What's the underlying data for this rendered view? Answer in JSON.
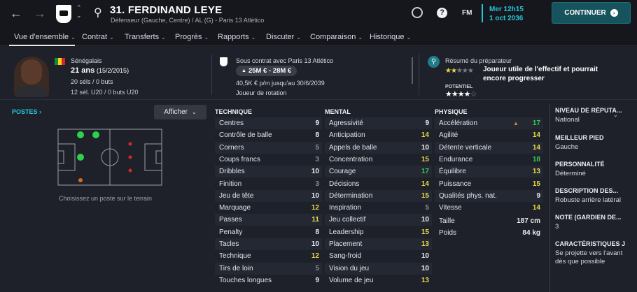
{
  "header": {
    "player_title": "31. FERDINAND LEYE",
    "subtitle": "Défenseur (Gauche, Centre) / AL (G) - Paris 13 Atlético",
    "date_line1": "Mer 12h15",
    "date_line2": "1 oct 2036",
    "fm_label": "FM",
    "continue_label": "CONTINUER"
  },
  "tabs": [
    {
      "label": "Vue d'ensemble"
    },
    {
      "label": "Contrat"
    },
    {
      "label": "Transferts"
    },
    {
      "label": "Progrès"
    },
    {
      "label": "Rapports"
    },
    {
      "label": "Discuter"
    },
    {
      "label": "Comparaison"
    },
    {
      "label": "Historique"
    }
  ],
  "bio": {
    "nationality": "Sénégalais",
    "age": "21 ans",
    "birth": "(15/2/2015)",
    "caps": "20 séls / 0 buts",
    "u20": "12 sél. U20 / 0 buts U20"
  },
  "contract": {
    "line1": "Sous contrat avec Paris 13 Atlético",
    "value": "25M € - 28M €",
    "wage": "40,5K € p/m jusqu'au 30/6/2039",
    "role": "Joueur de rotation"
  },
  "coach": {
    "title": "Résumé du préparateur",
    "summary": "Joueur utile de l'effectif et pourrait encore progresser",
    "potential_label": "POTENTIEL",
    "ability_stars": 2.5,
    "potential_stars": 4.5
  },
  "positions": {
    "label": "POSTES",
    "button": "Afficher",
    "hint": "Choisissez un poste sur le terrain"
  },
  "technique": {
    "title": "TECHNIQUE",
    "rows": [
      {
        "name": "Centres",
        "value": "9"
      },
      {
        "name": "Contrôle de balle",
        "value": "8"
      },
      {
        "name": "Corners",
        "value": "5"
      },
      {
        "name": "Coups francs",
        "value": "3"
      },
      {
        "name": "Dribbles",
        "value": "10"
      },
      {
        "name": "Finition",
        "value": "3"
      },
      {
        "name": "Jeu de tête",
        "value": "10"
      },
      {
        "name": "Marquage",
        "value": "12"
      },
      {
        "name": "Passes",
        "value": "11"
      },
      {
        "name": "Penalty",
        "value": "8"
      },
      {
        "name": "Tacles",
        "value": "10"
      },
      {
        "name": "Technique",
        "value": "12"
      },
      {
        "name": "Tirs de loin",
        "value": "5"
      },
      {
        "name": "Touches longues",
        "value": "9"
      }
    ]
  },
  "mental": {
    "title": "MENTAL",
    "rows": [
      {
        "name": "Agressivité",
        "value": "9"
      },
      {
        "name": "Anticipation",
        "value": "14"
      },
      {
        "name": "Appels de balle",
        "value": "10"
      },
      {
        "name": "Concentration",
        "value": "15"
      },
      {
        "name": "Courage",
        "value": "17"
      },
      {
        "name": "Décisions",
        "value": "14"
      },
      {
        "name": "Détermination",
        "value": "15"
      },
      {
        "name": "Inspiration",
        "value": "5"
      },
      {
        "name": "Jeu collectif",
        "value": "10"
      },
      {
        "name": "Leadership",
        "value": "15"
      },
      {
        "name": "Placement",
        "value": "13"
      },
      {
        "name": "Sang-froid",
        "value": "10"
      },
      {
        "name": "Vision du jeu",
        "value": "10"
      },
      {
        "name": "Volume de jeu",
        "value": "13"
      }
    ]
  },
  "physique": {
    "title": "PHYSIQUE",
    "rows": [
      {
        "name": "Accélération",
        "value": "17"
      },
      {
        "name": "Agilité",
        "value": "14"
      },
      {
        "name": "Détente verticale",
        "value": "14"
      },
      {
        "name": "Endurance",
        "value": "18"
      },
      {
        "name": "Équilibre",
        "value": "13"
      },
      {
        "name": "Puissance",
        "value": "15"
      },
      {
        "name": "Qualités phys. nat.",
        "value": "9"
      },
      {
        "name": "Vitesse",
        "value": "14"
      }
    ],
    "height_label": "Taille",
    "height": "187 cm",
    "weight_label": "Poids",
    "weight": "84 kg"
  },
  "side": [
    {
      "title": "NIVEAU DE RÉPUTA...",
      "value": "National"
    },
    {
      "title": "MEILLEUR PIED",
      "value": "Gauche"
    },
    {
      "title": "PERSONNALITÉ",
      "value": "Déterminé"
    },
    {
      "title": "DESCRIPTION DES...",
      "value": "Robuste arrière latéral"
    },
    {
      "title": "NOTE (GARDIEN DE...",
      "value": "3"
    },
    {
      "title": "CARACTÉRISTIQUES J",
      "value": "Se projette vers l'avant dès que possible"
    }
  ]
}
